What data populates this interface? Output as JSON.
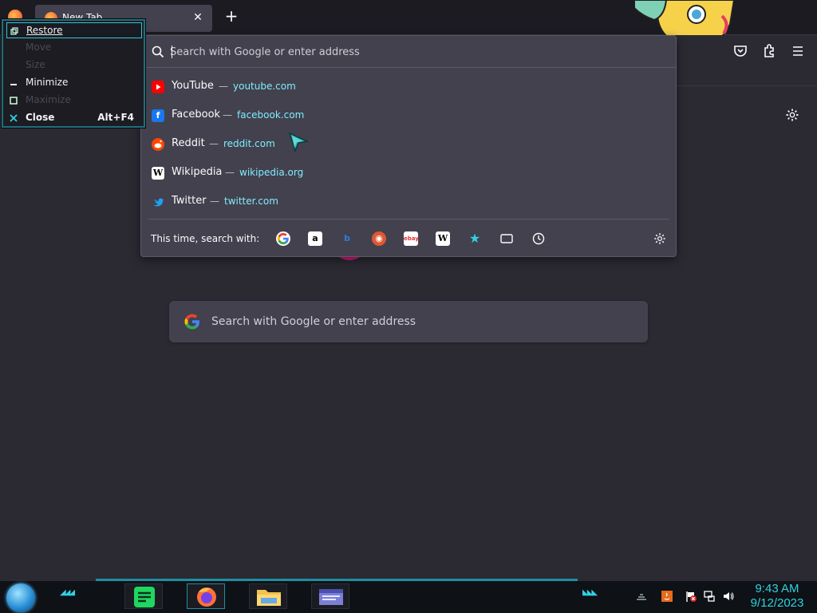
{
  "tabstrip": {
    "tab_title": "New Tab",
    "close_glyph": "✕",
    "newtab_glyph": "+"
  },
  "urlbar": {
    "placeholder": "Search with Google or enter address",
    "suggestions": [
      {
        "title": "YouTube",
        "sep": "—",
        "url": "youtube.com",
        "icon": "youtube-icon",
        "color": "#ff0000"
      },
      {
        "title": "Facebook",
        "sep": "—",
        "url": "facebook.com",
        "icon": "facebook-icon",
        "color": "#1877f2"
      },
      {
        "title": "Reddit",
        "sep": "—",
        "url": "reddit.com",
        "icon": "reddit-icon",
        "color": "#ff4500"
      },
      {
        "title": "Wikipedia",
        "sep": "—",
        "url": "wikipedia.org",
        "icon": "wikipedia-icon",
        "color": "#ffffff"
      },
      {
        "title": "Twitter",
        "sep": "—",
        "url": "twitter.com",
        "icon": "twitter-icon",
        "color": "#1da1f2"
      }
    ],
    "search_with_label": "This time, search with:",
    "engines": [
      "google-icon",
      "amazon-icon",
      "bing-icon",
      "duckduckgo-icon",
      "ebay-icon",
      "wikipedia-icon",
      "bookmarks-icon",
      "tabs-icon",
      "history-icon"
    ]
  },
  "page": {
    "search_placeholder": "Search with Google or enter address"
  },
  "system_menu": {
    "items": [
      {
        "label": "Restore",
        "enabled": true,
        "accel": ""
      },
      {
        "label": "Move",
        "enabled": false,
        "accel": ""
      },
      {
        "label": "Size",
        "enabled": false,
        "accel": ""
      },
      {
        "label": "Minimize",
        "enabled": true,
        "accel": ""
      },
      {
        "label": "Maximize",
        "enabled": false,
        "accel": ""
      },
      {
        "label": "Close",
        "enabled": true,
        "accel": "Alt+F4"
      }
    ]
  },
  "taskbar": {
    "clock_time": "9:43 AM",
    "clock_date": "9/12/2023",
    "accent": "#2ed2e0"
  }
}
